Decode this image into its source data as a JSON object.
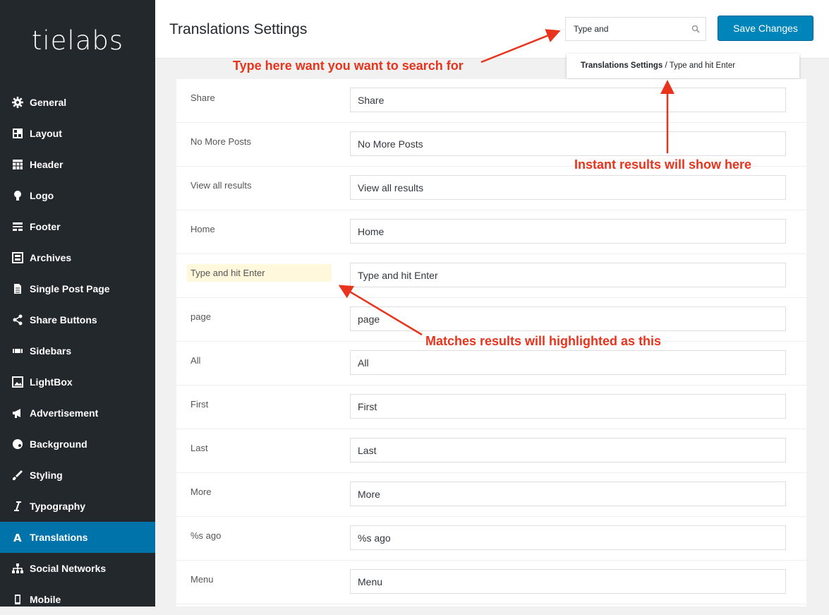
{
  "brand": {
    "logo_text": "tielabs"
  },
  "sidebar": {
    "items": [
      {
        "label": "General",
        "icon": "gear-icon"
      },
      {
        "label": "Layout",
        "icon": "layout-icon"
      },
      {
        "label": "Header",
        "icon": "table-icon"
      },
      {
        "label": "Logo",
        "icon": "lightbulb-icon"
      },
      {
        "label": "Footer",
        "icon": "footer-icon"
      },
      {
        "label": "Archives",
        "icon": "archive-icon"
      },
      {
        "label": "Single Post Page",
        "icon": "document-icon"
      },
      {
        "label": "Share Buttons",
        "icon": "share-icon"
      },
      {
        "label": "Sidebars",
        "icon": "sidebars-icon"
      },
      {
        "label": "LightBox",
        "icon": "image-icon"
      },
      {
        "label": "Advertisement",
        "icon": "megaphone-icon"
      },
      {
        "label": "Background",
        "icon": "palette-icon"
      },
      {
        "label": "Styling",
        "icon": "brush-icon"
      },
      {
        "label": "Typography",
        "icon": "italic-icon"
      },
      {
        "label": "Translations",
        "icon": "translation-icon",
        "active": true
      },
      {
        "label": "Social Networks",
        "icon": "sitemap-icon"
      },
      {
        "label": "Mobile",
        "icon": "mobile-icon"
      }
    ]
  },
  "header": {
    "title": "Translations Settings",
    "search": {
      "value": "Type and"
    },
    "save_label": "Save Changes"
  },
  "search_results": {
    "section": "Translations Settings",
    "separator": " / ",
    "match": "Type and hit Enter"
  },
  "rows": [
    {
      "label": "Share",
      "value": "Share"
    },
    {
      "label": "No More Posts",
      "value": "No More Posts"
    },
    {
      "label": "View all results",
      "value": "View all results"
    },
    {
      "label": "Home",
      "value": "Home"
    },
    {
      "label": "Type and hit Enter",
      "value": "Type and hit Enter",
      "highlighted": true
    },
    {
      "label": "page",
      "value": "page"
    },
    {
      "label": "All",
      "value": "All"
    },
    {
      "label": "First",
      "value": "First"
    },
    {
      "label": "Last",
      "value": "Last"
    },
    {
      "label": "More",
      "value": "More"
    },
    {
      "label": "%s ago",
      "value": "%s ago"
    },
    {
      "label": "Menu",
      "value": "Menu"
    }
  ],
  "annotations": {
    "search_hint": "Type here want you want to search for",
    "results_hint": "Instant results will show here",
    "match_hint": "Matches results will highlighted as this"
  },
  "colors": {
    "sidebar_bg": "#23282d",
    "active_bg": "#0073aa",
    "button_bg": "#0085ba",
    "annotation": "#e8341c",
    "highlight": "#fff8dc"
  }
}
